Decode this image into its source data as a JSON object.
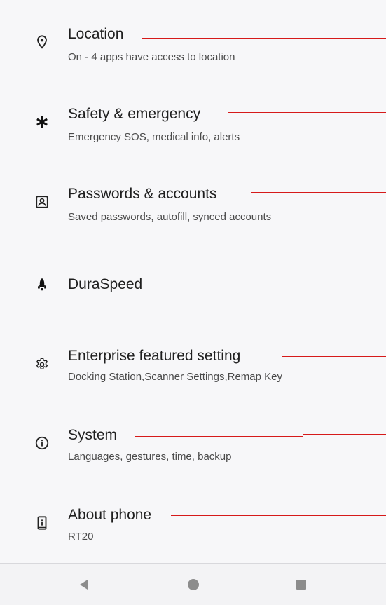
{
  "settings_items": [
    {
      "icon": "location-pin-icon",
      "title": "Location",
      "summary": "On - 4 apps have access to location"
    },
    {
      "icon": "asterisk-icon",
      "title": "Safety & emergency",
      "summary": "Emergency SOS, medical info, alerts"
    },
    {
      "icon": "account-box-icon",
      "title": "Passwords & accounts",
      "summary": "Saved passwords, autofill, synced accounts"
    },
    {
      "icon": "rocket-icon",
      "title": "DuraSpeed",
      "summary": ""
    },
    {
      "icon": "gear-icon",
      "title": "Enterprise featured setting",
      "summary": "Docking Station,Scanner Settings,Remap Key"
    },
    {
      "icon": "info-icon",
      "title": "System",
      "summary": "Languages, gestures, time, backup"
    },
    {
      "icon": "phone-icon",
      "title": "About phone",
      "summary": "RT20"
    }
  ],
  "navigation_bar": {
    "back": "back-triangle-icon",
    "home": "home-circle-icon",
    "recents": "recents-square-icon"
  },
  "annotation_color": "#d61a1a"
}
